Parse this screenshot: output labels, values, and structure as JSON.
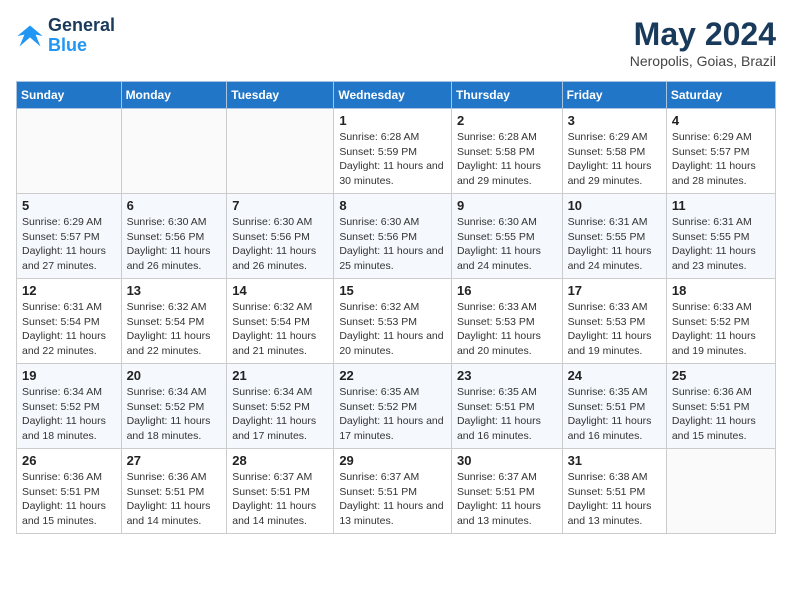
{
  "header": {
    "logo_line1": "General",
    "logo_line2": "Blue",
    "month_title": "May 2024",
    "location": "Neropolis, Goias, Brazil"
  },
  "weekdays": [
    "Sunday",
    "Monday",
    "Tuesday",
    "Wednesday",
    "Thursday",
    "Friday",
    "Saturday"
  ],
  "weeks": [
    [
      {
        "day": "",
        "sunrise": "",
        "sunset": "",
        "daylight": ""
      },
      {
        "day": "",
        "sunrise": "",
        "sunset": "",
        "daylight": ""
      },
      {
        "day": "",
        "sunrise": "",
        "sunset": "",
        "daylight": ""
      },
      {
        "day": "1",
        "sunrise": "Sunrise: 6:28 AM",
        "sunset": "Sunset: 5:59 PM",
        "daylight": "Daylight: 11 hours and 30 minutes."
      },
      {
        "day": "2",
        "sunrise": "Sunrise: 6:28 AM",
        "sunset": "Sunset: 5:58 PM",
        "daylight": "Daylight: 11 hours and 29 minutes."
      },
      {
        "day": "3",
        "sunrise": "Sunrise: 6:29 AM",
        "sunset": "Sunset: 5:58 PM",
        "daylight": "Daylight: 11 hours and 29 minutes."
      },
      {
        "day": "4",
        "sunrise": "Sunrise: 6:29 AM",
        "sunset": "Sunset: 5:57 PM",
        "daylight": "Daylight: 11 hours and 28 minutes."
      }
    ],
    [
      {
        "day": "5",
        "sunrise": "Sunrise: 6:29 AM",
        "sunset": "Sunset: 5:57 PM",
        "daylight": "Daylight: 11 hours and 27 minutes."
      },
      {
        "day": "6",
        "sunrise": "Sunrise: 6:30 AM",
        "sunset": "Sunset: 5:56 PM",
        "daylight": "Daylight: 11 hours and 26 minutes."
      },
      {
        "day": "7",
        "sunrise": "Sunrise: 6:30 AM",
        "sunset": "Sunset: 5:56 PM",
        "daylight": "Daylight: 11 hours and 26 minutes."
      },
      {
        "day": "8",
        "sunrise": "Sunrise: 6:30 AM",
        "sunset": "Sunset: 5:56 PM",
        "daylight": "Daylight: 11 hours and 25 minutes."
      },
      {
        "day": "9",
        "sunrise": "Sunrise: 6:30 AM",
        "sunset": "Sunset: 5:55 PM",
        "daylight": "Daylight: 11 hours and 24 minutes."
      },
      {
        "day": "10",
        "sunrise": "Sunrise: 6:31 AM",
        "sunset": "Sunset: 5:55 PM",
        "daylight": "Daylight: 11 hours and 24 minutes."
      },
      {
        "day": "11",
        "sunrise": "Sunrise: 6:31 AM",
        "sunset": "Sunset: 5:55 PM",
        "daylight": "Daylight: 11 hours and 23 minutes."
      }
    ],
    [
      {
        "day": "12",
        "sunrise": "Sunrise: 6:31 AM",
        "sunset": "Sunset: 5:54 PM",
        "daylight": "Daylight: 11 hours and 22 minutes."
      },
      {
        "day": "13",
        "sunrise": "Sunrise: 6:32 AM",
        "sunset": "Sunset: 5:54 PM",
        "daylight": "Daylight: 11 hours and 22 minutes."
      },
      {
        "day": "14",
        "sunrise": "Sunrise: 6:32 AM",
        "sunset": "Sunset: 5:54 PM",
        "daylight": "Daylight: 11 hours and 21 minutes."
      },
      {
        "day": "15",
        "sunrise": "Sunrise: 6:32 AM",
        "sunset": "Sunset: 5:53 PM",
        "daylight": "Daylight: 11 hours and 20 minutes."
      },
      {
        "day": "16",
        "sunrise": "Sunrise: 6:33 AM",
        "sunset": "Sunset: 5:53 PM",
        "daylight": "Daylight: 11 hours and 20 minutes."
      },
      {
        "day": "17",
        "sunrise": "Sunrise: 6:33 AM",
        "sunset": "Sunset: 5:53 PM",
        "daylight": "Daylight: 11 hours and 19 minutes."
      },
      {
        "day": "18",
        "sunrise": "Sunrise: 6:33 AM",
        "sunset": "Sunset: 5:52 PM",
        "daylight": "Daylight: 11 hours and 19 minutes."
      }
    ],
    [
      {
        "day": "19",
        "sunrise": "Sunrise: 6:34 AM",
        "sunset": "Sunset: 5:52 PM",
        "daylight": "Daylight: 11 hours and 18 minutes."
      },
      {
        "day": "20",
        "sunrise": "Sunrise: 6:34 AM",
        "sunset": "Sunset: 5:52 PM",
        "daylight": "Daylight: 11 hours and 18 minutes."
      },
      {
        "day": "21",
        "sunrise": "Sunrise: 6:34 AM",
        "sunset": "Sunset: 5:52 PM",
        "daylight": "Daylight: 11 hours and 17 minutes."
      },
      {
        "day": "22",
        "sunrise": "Sunrise: 6:35 AM",
        "sunset": "Sunset: 5:52 PM",
        "daylight": "Daylight: 11 hours and 17 minutes."
      },
      {
        "day": "23",
        "sunrise": "Sunrise: 6:35 AM",
        "sunset": "Sunset: 5:51 PM",
        "daylight": "Daylight: 11 hours and 16 minutes."
      },
      {
        "day": "24",
        "sunrise": "Sunrise: 6:35 AM",
        "sunset": "Sunset: 5:51 PM",
        "daylight": "Daylight: 11 hours and 16 minutes."
      },
      {
        "day": "25",
        "sunrise": "Sunrise: 6:36 AM",
        "sunset": "Sunset: 5:51 PM",
        "daylight": "Daylight: 11 hours and 15 minutes."
      }
    ],
    [
      {
        "day": "26",
        "sunrise": "Sunrise: 6:36 AM",
        "sunset": "Sunset: 5:51 PM",
        "daylight": "Daylight: 11 hours and 15 minutes."
      },
      {
        "day": "27",
        "sunrise": "Sunrise: 6:36 AM",
        "sunset": "Sunset: 5:51 PM",
        "daylight": "Daylight: 11 hours and 14 minutes."
      },
      {
        "day": "28",
        "sunrise": "Sunrise: 6:37 AM",
        "sunset": "Sunset: 5:51 PM",
        "daylight": "Daylight: 11 hours and 14 minutes."
      },
      {
        "day": "29",
        "sunrise": "Sunrise: 6:37 AM",
        "sunset": "Sunset: 5:51 PM",
        "daylight": "Daylight: 11 hours and 13 minutes."
      },
      {
        "day": "30",
        "sunrise": "Sunrise: 6:37 AM",
        "sunset": "Sunset: 5:51 PM",
        "daylight": "Daylight: 11 hours and 13 minutes."
      },
      {
        "day": "31",
        "sunrise": "Sunrise: 6:38 AM",
        "sunset": "Sunset: 5:51 PM",
        "daylight": "Daylight: 11 hours and 13 minutes."
      },
      {
        "day": "",
        "sunrise": "",
        "sunset": "",
        "daylight": ""
      }
    ]
  ]
}
